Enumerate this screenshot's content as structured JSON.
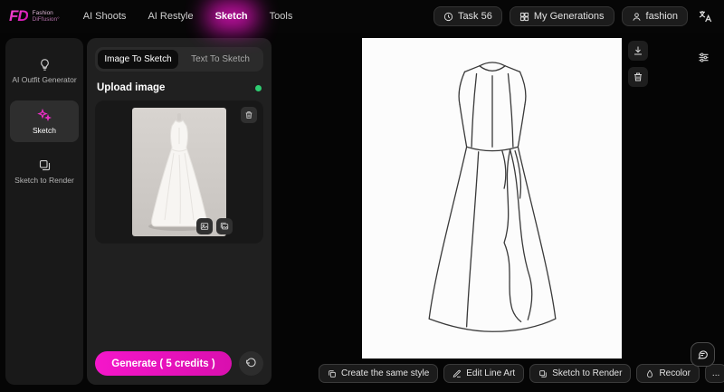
{
  "header": {
    "logo_text": "FD",
    "brand_line1": "Fashion",
    "brand_line2": "DiFfusion°",
    "nav": [
      {
        "label": "AI Shoots"
      },
      {
        "label": "AI Restyle"
      },
      {
        "label": "Sketch"
      },
      {
        "label": "Tools"
      }
    ],
    "task_button": "Task 56",
    "generations_button": "My Generations",
    "account_button": "fashion"
  },
  "sidebar": {
    "items": [
      {
        "label": "AI Outfit Generator"
      },
      {
        "label": "Sketch"
      },
      {
        "label": "Sketch to Render"
      }
    ]
  },
  "panel": {
    "tabs": [
      {
        "label": "Image To Sketch"
      },
      {
        "label": "Text To Sketch"
      }
    ],
    "upload_label": "Upload image",
    "generate_label": "Generate ( 5 credits )"
  },
  "toolbar": {
    "buttons": [
      {
        "label": "Create the same style"
      },
      {
        "label": "Edit Line Art"
      },
      {
        "label": "Sketch to Render"
      },
      {
        "label": "Recolor"
      },
      {
        "label": "..."
      }
    ]
  },
  "icons": {
    "task": "clock-icon",
    "generations": "grid-icon",
    "account": "user-icon",
    "translate": "translate-icon",
    "outfit": "lightbulb-icon",
    "sketch": "sparkles-icon",
    "render": "layers-icon",
    "delete": "trash-icon",
    "download": "download-icon",
    "reset": "rotate-ccw-icon",
    "feedback": "chat-icon"
  },
  "colors": {
    "accent": "#e912c0",
    "success": "#2ecc71"
  }
}
